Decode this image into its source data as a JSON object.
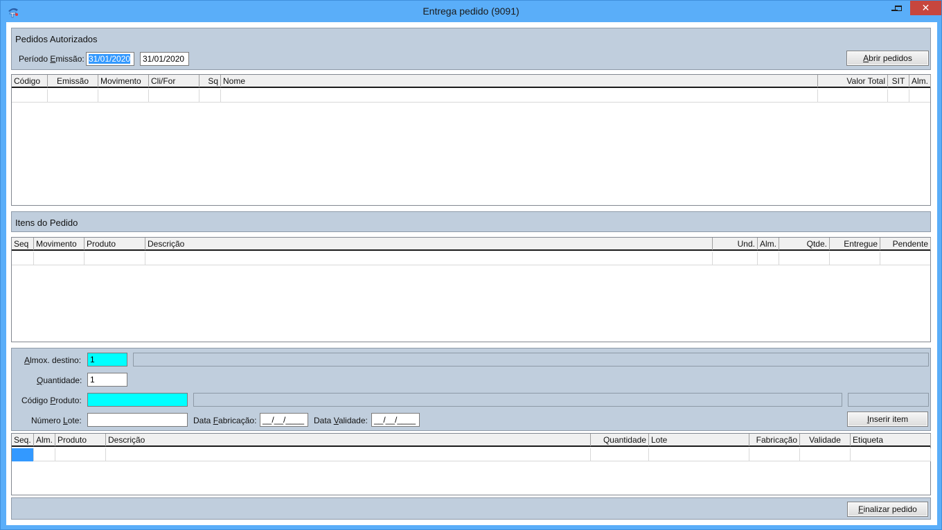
{
  "window": {
    "title": "Entrega pedido (9091)",
    "close_glyph": "✕"
  },
  "pedidos": {
    "title": "Pedidos Autorizados",
    "periodo_label_pre": "Período ",
    "periodo_label_ul": "E",
    "periodo_label_post": "missão:",
    "date_from": "31/01/2020",
    "date_to": "31/01/2020",
    "abrir_pre": "",
    "abrir_ul": "A",
    "abrir_post": "brir pedidos",
    "columns": [
      "Código",
      "Emissão",
      "Movimento",
      "Cli/For",
      "Sq",
      "Nome",
      "Valor Total",
      "SIT",
      "Alm."
    ]
  },
  "itens": {
    "title": "Itens do Pedido",
    "columns": [
      "Seq",
      "Movimento",
      "Produto",
      "Descrição",
      "Und.",
      "Alm.",
      "Qtde.",
      "Entregue",
      "Pendente"
    ]
  },
  "form": {
    "almox_ul": "A",
    "almox_post": "lmox. destino:",
    "almox_value": "1",
    "almox_desc": "",
    "qtd_ul": "Q",
    "qtd_post": "uantidade:",
    "qtd_value": "1",
    "cod_pre": "Código ",
    "cod_ul": "P",
    "cod_post": "roduto:",
    "cod_value": "",
    "cod_desc": "",
    "cod_extra": "",
    "lote_pre": "Número ",
    "lote_ul": "L",
    "lote_post": "ote:",
    "lote_value": "",
    "fab_pre": "Data ",
    "fab_ul": "F",
    "fab_post": "abricação:",
    "fab_value": "__/__/____",
    "val_pre": "Data ",
    "val_ul": "V",
    "val_post": "alidade:",
    "val_value": "__/__/____",
    "inserir_pre": "",
    "inserir_ul": "I",
    "inserir_post": "nserir item"
  },
  "lista": {
    "columns": [
      "Seq.",
      "Alm.",
      "Produto",
      "Descrição",
      "Quantidade",
      "Lote",
      "Fabricação",
      "Validade",
      "Etiqueta"
    ]
  },
  "footer": {
    "finalizar_pre": "",
    "finalizar_ul": "F",
    "finalizar_post": "inalizar pedido"
  },
  "colors": {
    "titlebar": "#5aaef9",
    "panel": "#c0cedd",
    "highlight_field": "#00ffff",
    "selection": "#3399ff",
    "close_button": "#c7463e"
  }
}
